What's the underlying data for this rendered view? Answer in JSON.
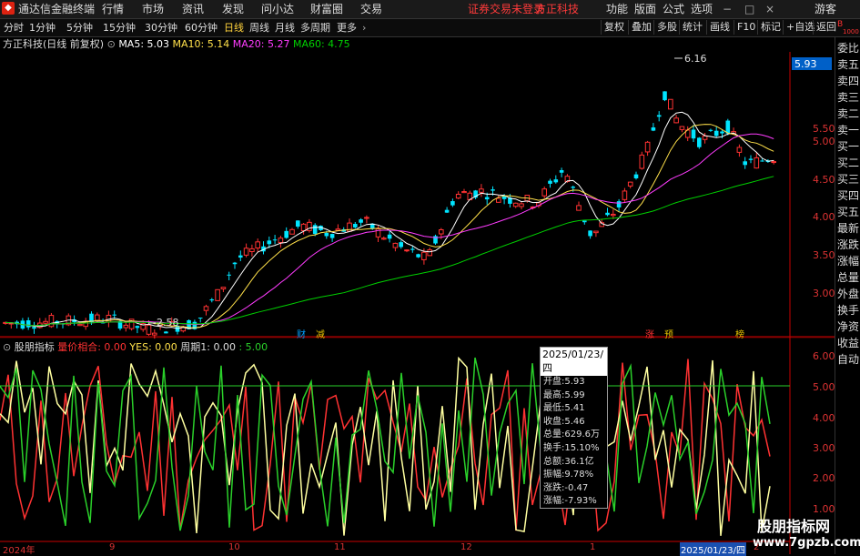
{
  "menubar": {
    "app_title": "通达信金融终端",
    "menus": [
      "行情",
      "市场",
      "资讯",
      "发现",
      "问小达",
      "财富圈",
      "交易"
    ],
    "warning": "证券交易未登录",
    "broker": "方正科技",
    "right_menus": [
      "功能",
      "版面",
      "公式",
      "选项"
    ],
    "guest": "游客"
  },
  "periodbar": {
    "periods": [
      "分时",
      "1分钟",
      "5分钟",
      "15分钟",
      "30分钟",
      "60分钟",
      "日线",
      "周线",
      "月线",
      "多周期",
      "更多"
    ],
    "active": "日线",
    "tools": [
      "复权",
      "叠加",
      "多股",
      "统计",
      "画线",
      "F10",
      "标记",
      "+自选",
      "返回"
    ]
  },
  "stock": {
    "name": "方正科技",
    "mode": "(日线 前复权)",
    "ma5_label": "MA5: 5.03",
    "ma10_label": "MA10: 5.14",
    "ma20_label": "MA20: 5.27",
    "ma60_label": "MA60: 4.75",
    "current_price": "5.93",
    "high_marker": "6.16",
    "low_marker": "2.58"
  },
  "colors": {
    "up": "#ff3232",
    "down": "#00e4ff",
    "ma5": "#ffffff",
    "ma10": "#ffe04a",
    "ma20": "#ff3cff",
    "ma60": "#00d000",
    "axis": "#c80000"
  },
  "main_yaxis": [
    "5.50",
    "5.00",
    "4.50",
    "4.00",
    "3.50",
    "3.00"
  ],
  "sub_yaxis": [
    "6.00",
    "5.00",
    "4.00",
    "3.00",
    "2.00",
    "1.00"
  ],
  "events": [
    "财",
    "减",
    "涨",
    "预",
    "榜"
  ],
  "indicator": {
    "name": "股朋指标",
    "l1": "量价相合: 0.00",
    "l2": "YES: 0.00",
    "l3": "周期1: 0.00",
    "l4": ": 5.00"
  },
  "tooltip": {
    "date": "2025/01/23/四",
    "rows": [
      "开盘:5.93",
      "最高:5.99",
      "最低:5.41",
      "收盘:5.46",
      "总量:629.6万",
      "换手:15.10%",
      "总额:36.1亿",
      "振幅:9.78%",
      "涨跌:-0.47",
      "涨幅:-7.93%"
    ]
  },
  "right_panel": [
    "委比",
    "卖五",
    "卖四",
    "卖三",
    "卖二",
    "卖一",
    "买一",
    "买二",
    "买三",
    "买四",
    "买五",
    "最新",
    "涨跌",
    "涨幅",
    "总量",
    "外盘",
    "换手",
    "净资",
    "收益",
    "自动"
  ],
  "right_panel_top": "B",
  "right_panel_top2": "1000",
  "xaxis": [
    "2024年",
    "9",
    "10",
    "11",
    "12",
    "1",
    "2025/01/23/四",
    "2"
  ],
  "watermark": {
    "line1": "股朋指标网",
    "line2": "www.7gpzb.com"
  }
}
